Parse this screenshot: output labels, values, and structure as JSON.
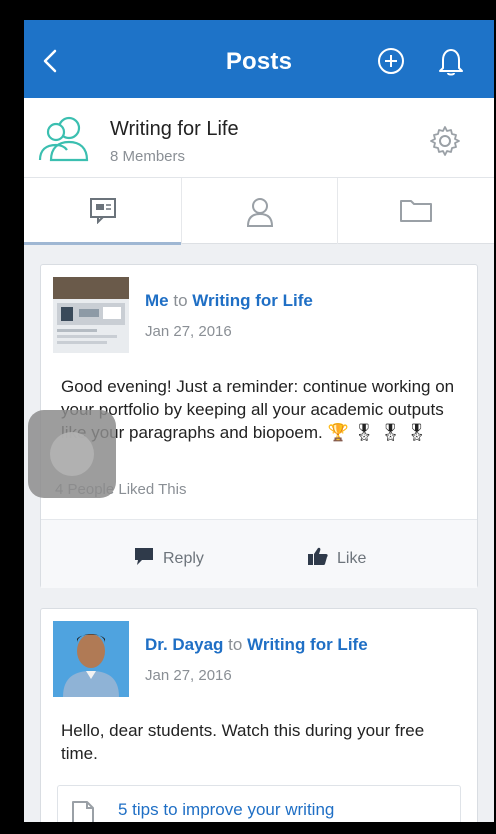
{
  "header": {
    "title": "Posts",
    "back_icon": "chevron-left-icon",
    "add_icon": "plus-circle-icon",
    "notification_icon": "bell-icon",
    "accent": "#1e73c8"
  },
  "group": {
    "name": "Writing for Life",
    "members": "8 Members",
    "icon": "users-icon",
    "settings_icon": "gear-icon"
  },
  "tabs": [
    {
      "icon": "posts-icon",
      "active": true
    },
    {
      "icon": "user-icon",
      "active": false
    },
    {
      "icon": "folder-icon",
      "active": false
    }
  ],
  "posts": [
    {
      "author": "Me",
      "to_word": "to",
      "group": "Writing for Life",
      "date": "Jan 27, 2016",
      "text": "Good evening! Just a reminder: continue working on your portfolio by keeping all your academic outputs like your paragraphs and biopoem.",
      "emojis": "🏆 🎖 🎖 🎖",
      "likes": "4 People Liked This",
      "reply_label": "Reply",
      "like_label": "Like"
    },
    {
      "author": "Dr. Dayag",
      "to_word": "to",
      "group": "Writing for Life",
      "date": "Jan 27, 2016",
      "text": "Hello, dear students. Watch this during your free time.",
      "link_title": "5 tips to improve your writing"
    }
  ]
}
